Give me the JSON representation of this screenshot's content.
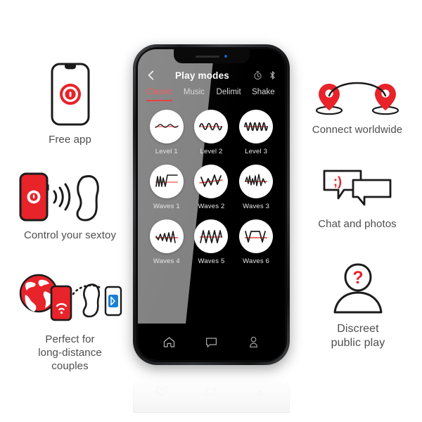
{
  "theme": {
    "brand_red": "#e8232a",
    "accent_red": "#e8423f",
    "caption_gray": "#4d4d4d",
    "screen_black": "#000000",
    "bluetooth_blue": "#1b7fd4"
  },
  "features_left": [
    {
      "id": "free-app",
      "caption": "Free app",
      "icon": "phone-with-lock-badge-icon"
    },
    {
      "id": "control-sextoy",
      "caption": "Control your sextoy",
      "icon": "red-phone-signal-to-toy-icon"
    },
    {
      "id": "long-distance",
      "caption": "Perfect for\nlong-distance\ncouples",
      "icon": "globe-phone-toy-bluetooth-icon"
    }
  ],
  "features_right": [
    {
      "id": "connect-worldwide",
      "caption": "Connect worldwide",
      "icon": "two-map-pins-arc-icon"
    },
    {
      "id": "chat-photos",
      "caption": "Chat and photos",
      "icon": "two-speech-bubbles-wink-icon"
    },
    {
      "id": "discreet-public-play",
      "caption": "Discreet\npublic play",
      "icon": "anonymous-person-question-icon"
    }
  ],
  "phone": {
    "appbar": {
      "back_icon": "chevron-left-icon",
      "title": "Play modes",
      "right_icons": [
        "timer-icon",
        "bluetooth-icon"
      ]
    },
    "tabs": [
      {
        "label": "Classic",
        "active": true
      },
      {
        "label": "Music",
        "active": false
      },
      {
        "label": "Delimit",
        "active": false
      },
      {
        "label": "Shake",
        "active": false
      }
    ],
    "modes": [
      {
        "label": "Level 1",
        "icon": "wave-sine-low-icon"
      },
      {
        "label": "Level 2",
        "icon": "wave-sine-medium-icon"
      },
      {
        "label": "Level 3",
        "icon": "wave-sine-high-icon"
      },
      {
        "label": "Waves 1",
        "icon": "wave-zigzag-flat-icon"
      },
      {
        "label": "Waves 2",
        "icon": "wave-peaks-icon"
      },
      {
        "label": "Waves 3",
        "icon": "wave-spike-cluster-icon"
      },
      {
        "label": "Waves 4",
        "icon": "wave-ramp-zigzag-icon"
      },
      {
        "label": "Waves 5",
        "icon": "wave-triangle-burst-icon"
      },
      {
        "label": "Waves 6",
        "icon": "wave-plateau-icon"
      }
    ],
    "bottom_nav": [
      {
        "id": "home",
        "icon": "home-icon"
      },
      {
        "id": "chat",
        "icon": "chat-bubble-icon"
      },
      {
        "id": "profile",
        "icon": "person-icon"
      }
    ],
    "notch": {
      "speaker": "speaker-slot",
      "camera": "front-camera-dot"
    }
  }
}
